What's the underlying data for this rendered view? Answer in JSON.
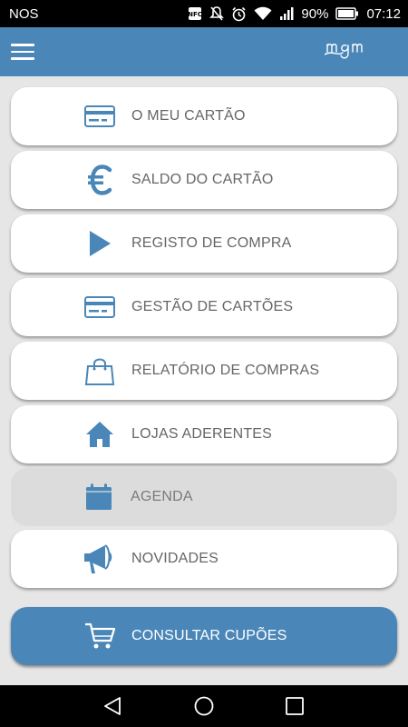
{
  "status_bar": {
    "carrier": "NOS",
    "battery_percent": "90%",
    "time": "07:12",
    "icons": [
      "nfc-icon",
      "mute-icon",
      "alarm-icon",
      "wifi-icon",
      "signal-icon",
      "battery-icon"
    ]
  },
  "app_bar": {
    "menu_icon": "hamburger-icon",
    "logo_text": "mgm"
  },
  "colors": {
    "accent": "#4a87b8",
    "background": "#e6e6e6",
    "item_background": "#ffffff",
    "label_text": "#666666"
  },
  "menu": {
    "items": [
      {
        "label": "O MEU CARTÃO",
        "icon": "card-icon",
        "state": "enabled"
      },
      {
        "label": "SALDO DO CARTÃO",
        "icon": "euro-icon",
        "state": "enabled"
      },
      {
        "label": "REGISTO DE COMPRA",
        "icon": "play-icon",
        "state": "enabled"
      },
      {
        "label": "GESTÃO DE CARTÕES",
        "icon": "card-icon",
        "state": "enabled"
      },
      {
        "label": "RELATÓRIO DE COMPRAS",
        "icon": "shopping-bag-icon",
        "state": "enabled"
      },
      {
        "label": "LOJAS ADERENTES",
        "icon": "home-icon",
        "state": "enabled"
      },
      {
        "label": "AGENDA",
        "icon": "calendar-icon",
        "state": "disabled"
      },
      {
        "label": "NOVIDADES",
        "icon": "megaphone-icon",
        "state": "enabled"
      },
      {
        "label": "CONSULTAR CUPÕES",
        "icon": "cart-icon",
        "state": "primary"
      }
    ]
  },
  "nav_bar": {
    "buttons": [
      "back-icon",
      "home-circle-icon",
      "recents-icon"
    ]
  }
}
